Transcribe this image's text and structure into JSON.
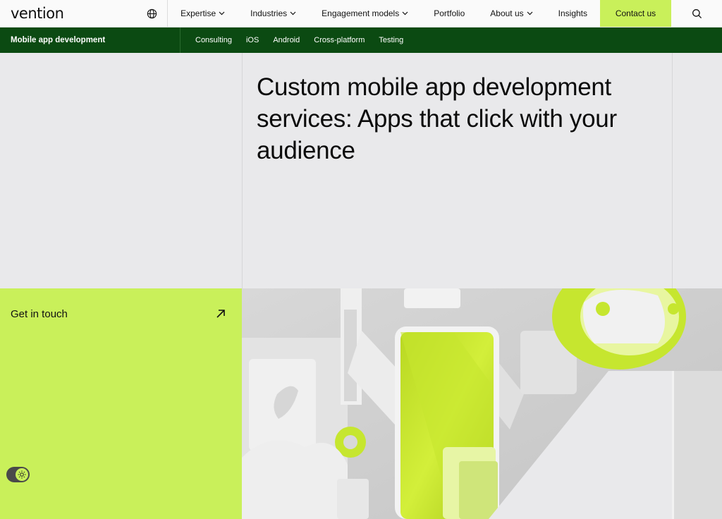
{
  "brand": {
    "logo_text": "vention"
  },
  "nav": {
    "items": [
      {
        "label": "Expertise",
        "has_dropdown": true
      },
      {
        "label": "Industries",
        "has_dropdown": true
      },
      {
        "label": "Engagement models",
        "has_dropdown": true
      },
      {
        "label": "Portfolio",
        "has_dropdown": false
      },
      {
        "label": "About us",
        "has_dropdown": true
      },
      {
        "label": "Insights",
        "has_dropdown": false
      }
    ],
    "contact_label": "Contact us"
  },
  "subnav": {
    "title": "Mobile app development",
    "links": [
      "Consulting",
      "iOS",
      "Android",
      "Cross-platform",
      "Testing"
    ]
  },
  "hero": {
    "title": "Custom mobile app development services: Apps that click with your audience"
  },
  "cta": {
    "label": "Get in touch"
  },
  "colors": {
    "accent_lime": "#c9f05a",
    "dark_green": "#0b4a12",
    "background": "#e9e9eb"
  },
  "icons": {
    "globe": "globe-icon",
    "search": "search-icon",
    "arrow": "arrow-up-right-icon",
    "theme": "sun-icon"
  }
}
